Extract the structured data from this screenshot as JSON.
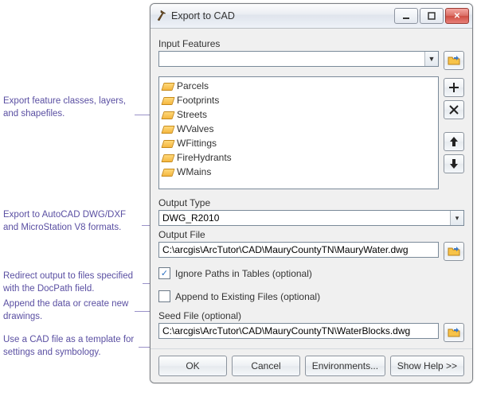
{
  "window": {
    "title": "Export to CAD"
  },
  "labels": {
    "input_features": "Input Features",
    "output_type": "Output Type",
    "output_file": "Output File",
    "seed_file": "Seed File (optional)"
  },
  "input_features_value": "",
  "feature_list": [
    "Parcels",
    "Footprints",
    "Streets",
    "WValves",
    "WFittings",
    "FireHydrants",
    "WMains"
  ],
  "output_type_value": "DWG_R2010",
  "output_file_value": "C:\\arcgis\\ArcTutor\\CAD\\MauryCountyTN\\MauryWater.dwg",
  "seed_file_value": "C:\\arcgis\\ArcTutor\\CAD\\MauryCountyTN\\WaterBlocks.dwg",
  "checkboxes": {
    "ignore_paths": {
      "label": "Ignore Paths in Tables (optional)",
      "checked": true
    },
    "append": {
      "label": "Append to Existing Files (optional)",
      "checked": false
    }
  },
  "buttons": {
    "ok": "OK",
    "cancel": "Cancel",
    "environments": "Environments...",
    "show_help": "Show Help >>"
  },
  "callouts": {
    "c1": "Export feature classes, layers, and shapefiles.",
    "c2": "Export to AutoCAD DWG/DXF and MicroStation V8 formats.",
    "c3": "Redirect output to files specified with the DocPath field.",
    "c4": "Append the data or create new drawings.",
    "c5": "Use a CAD file as a template for settings and symbology."
  }
}
